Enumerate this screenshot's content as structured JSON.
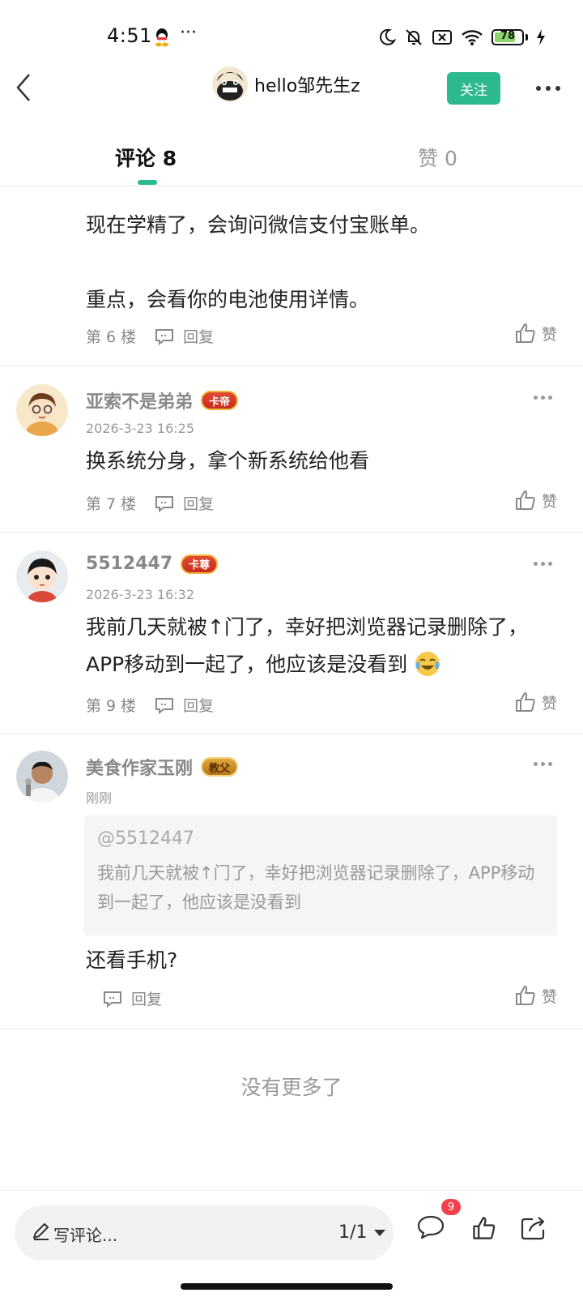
{
  "status_bar": {
    "time": "4:51",
    "dots": "···",
    "battery_level": "78",
    "battery_fraction": 0.78
  },
  "nav": {
    "username": "hello邹先生z",
    "follow_label": "关注"
  },
  "tabs": {
    "comments_label": "评论 8",
    "likes_label": "赞 0"
  },
  "comments": [
    {
      "text_lines": [
        "现在学精了，会询问微信支付宝账单。",
        "",
        "重点，会看你的电池使用详情。"
      ],
      "floor": "第 6 楼",
      "reply_label": "回复",
      "like_label": "赞"
    },
    {
      "user": "亚索不是弟弟",
      "badge": "卡帝",
      "time": "2026-3-23 16:25",
      "text": "换系统分身，拿个新系统给他看",
      "floor": "第 7 楼",
      "reply_label": "回复",
      "like_label": "赞"
    },
    {
      "user": "5512447",
      "badge": "卡尊",
      "time": "2026-3-23 16:32",
      "text": "我前几天就被↑门了，幸好把浏览器记录删除了，APP移动到一起了，他应该是没看到",
      "floor": "第 9 楼",
      "reply_label": "回复",
      "like_label": "赞"
    },
    {
      "user": "美食作家玉刚",
      "badge": "教父",
      "time": "刚刚",
      "quote_at": "@5512447",
      "quote_text": "我前几天就被↑门了，幸好把浏览器记录删除了，APP移动到一起了，他应该是没看到",
      "text": "还看手机?",
      "reply_label": "回复",
      "like_label": "赞"
    }
  ],
  "footer": {
    "no_more": "没有更多了"
  },
  "bottom_bar": {
    "write_placeholder": "写评论...",
    "page_indicator": "1/1",
    "comment_count_badge": "9"
  },
  "colors": {
    "accent": "#2bb98d",
    "badge_red": "#f2414c"
  }
}
